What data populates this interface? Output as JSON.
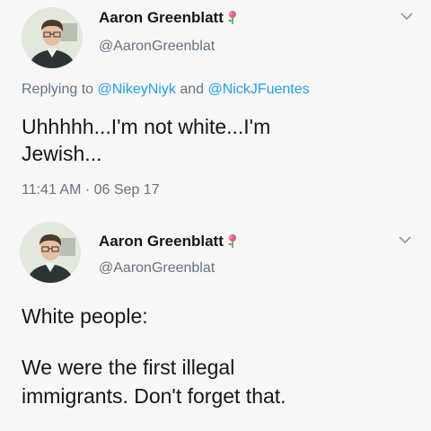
{
  "tweets": [
    {
      "author": "Aaron Greenblatt",
      "handle": "@AaronGreenblat",
      "replying_prefix": "Replying to",
      "mention_1": "@NikeyNiyk",
      "and": "and",
      "mention_2": "@NickJFuentes",
      "text_line_1": "Uhhhhh...I'm not white...I'm",
      "text_line_2": "Jewish...",
      "timestamp": "11:41 AM · 06 Sep 17"
    },
    {
      "author": "Aaron Greenblatt",
      "handle": "@AaronGreenblat",
      "text_intro": "White people:",
      "text_line_1": "We were the first illegal",
      "text_line_2": "immigrants. Don't forget that."
    }
  ],
  "icons": {
    "badge": "rose-icon",
    "menu": "chevron-down-icon",
    "avatar": "avatar"
  },
  "colors": {
    "background": "#f7f7f7",
    "link": "#1da1f2",
    "secondary_text": "#667380",
    "primary_text": "#14171a",
    "rose": "#e0607a"
  }
}
